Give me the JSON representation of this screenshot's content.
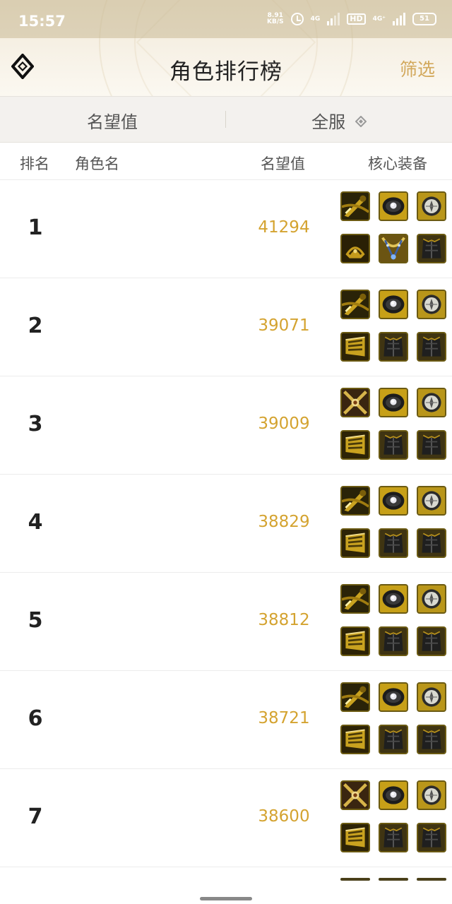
{
  "status_bar": {
    "time": "15:57",
    "net_speed_value": "8.91",
    "net_speed_unit": "KB/S",
    "network_tag_1": "4G",
    "hd_label": "HD",
    "network_tag_2": "4G⁺",
    "battery": "51"
  },
  "header": {
    "title": "角色排行榜",
    "filter_label": "筛选",
    "logo_icon": "diamond-logo-icon"
  },
  "filter_bar": {
    "left_label": "名望值",
    "right_label": "全服",
    "right_icon": "diamond-dropdown-icon"
  },
  "columns": {
    "rank": "排名",
    "name": "角色名",
    "fame": "名望值",
    "gear": "核心装备"
  },
  "rows": [
    {
      "rank": "1",
      "name": "",
      "fame": "41294",
      "gear": [
        "sword-icon",
        "ring-icon",
        "compass-icon",
        "gauntlet-icon",
        "necklace-icon",
        "armor-icon"
      ]
    },
    {
      "rank": "2",
      "name": "",
      "fame": "39071",
      "gear": [
        "sword-icon",
        "ring-icon",
        "compass-icon",
        "bracer-icon",
        "armor-icon",
        "armor-icon"
      ]
    },
    {
      "rank": "3",
      "name": "",
      "fame": "39009",
      "gear": [
        "crossed-blade-icon",
        "ring-icon",
        "compass-icon",
        "bracer-icon",
        "armor-icon",
        "armor-icon"
      ]
    },
    {
      "rank": "4",
      "name": "",
      "fame": "38829",
      "gear": [
        "sword-icon",
        "ring-icon",
        "compass-icon",
        "bracer-icon",
        "armor-icon",
        "armor-icon"
      ]
    },
    {
      "rank": "5",
      "name": "",
      "fame": "38812",
      "gear": [
        "sword-icon",
        "ring-icon",
        "compass-icon",
        "bracer-icon",
        "armor-icon",
        "armor-icon"
      ]
    },
    {
      "rank": "6",
      "name": "",
      "fame": "38721",
      "gear": [
        "sword-icon",
        "ring-icon",
        "compass-icon",
        "bracer-icon",
        "armor-icon",
        "armor-icon"
      ]
    },
    {
      "rank": "7",
      "name": "",
      "fame": "38600",
      "gear": [
        "crossed-blade-icon",
        "ring-icon",
        "compass-icon",
        "bracer-icon",
        "armor-icon",
        "armor-icon"
      ]
    }
  ],
  "colors": {
    "accent_gold": "#d4a330",
    "filter_text": "#d2a85b",
    "header_bg": "#f3ecdd"
  }
}
